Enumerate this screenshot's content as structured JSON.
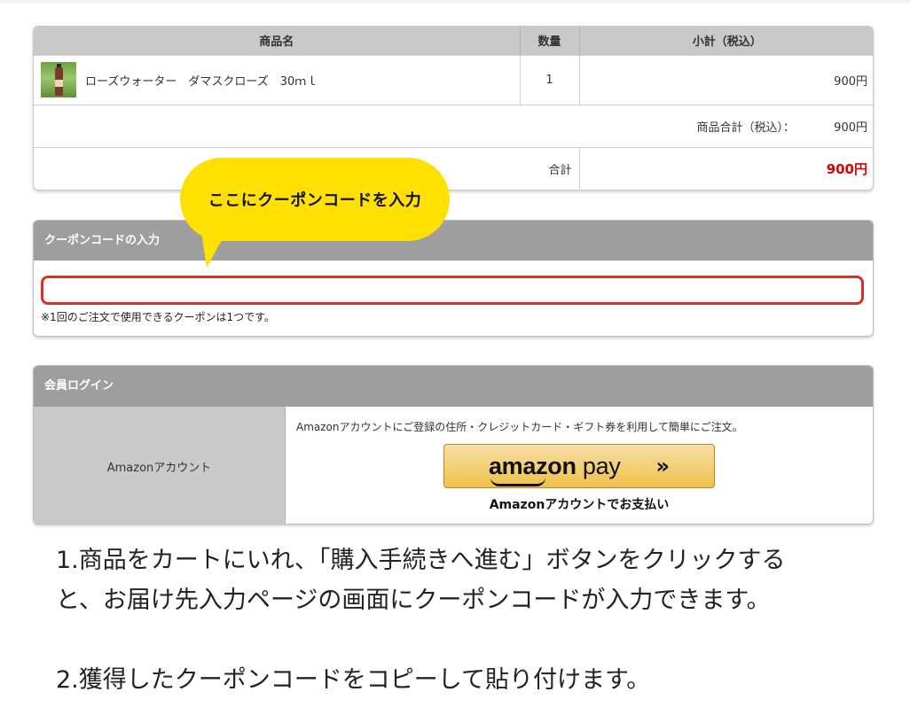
{
  "cart": {
    "headers": {
      "product": "商品名",
      "qty": "数量",
      "subtotal": "小計（税込）"
    },
    "item": {
      "name": "ローズウォーター　ダマスクローズ　30ｍｌ",
      "qty": "1",
      "price": "900円"
    },
    "subtotal_row": {
      "label": "商品合計（税込）：",
      "value": "900円"
    },
    "total_row": {
      "label": "合計",
      "value": "900円"
    },
    "colors": {
      "total": "#e00000",
      "header_bg": "#c9c9c9"
    }
  },
  "callout": {
    "text": "ここにクーポンコードを入力",
    "color": "#ffe000"
  },
  "coupon": {
    "title": "クーポンコードの入力",
    "value": "",
    "placeholder": "",
    "note": "※1回のご注文で使用できるクーポンは1つです。",
    "highlight_color": "#d93025"
  },
  "login": {
    "title": "会員ログイン",
    "left_label": "Amazonアカウント",
    "description": "Amazonアカウントにご登録の住所・クレジットカード・ギフト券を利用して簡単にご注文。",
    "button": {
      "brand_bold": "amazon",
      "brand_light": " pay",
      "chevron": "»"
    },
    "button_caption": "Amazonアカウントでお支払い"
  },
  "instructions": {
    "step1_line1": "1.商品をカートにいれ、「購入手続きへ進む」ボタンをクリックする",
    "step1_line2": "と、お届け先入力ページの画面にクーポンコードが入力できます。",
    "step2": "2.獲得したクーポンコードをコピーして貼り付けます。"
  }
}
